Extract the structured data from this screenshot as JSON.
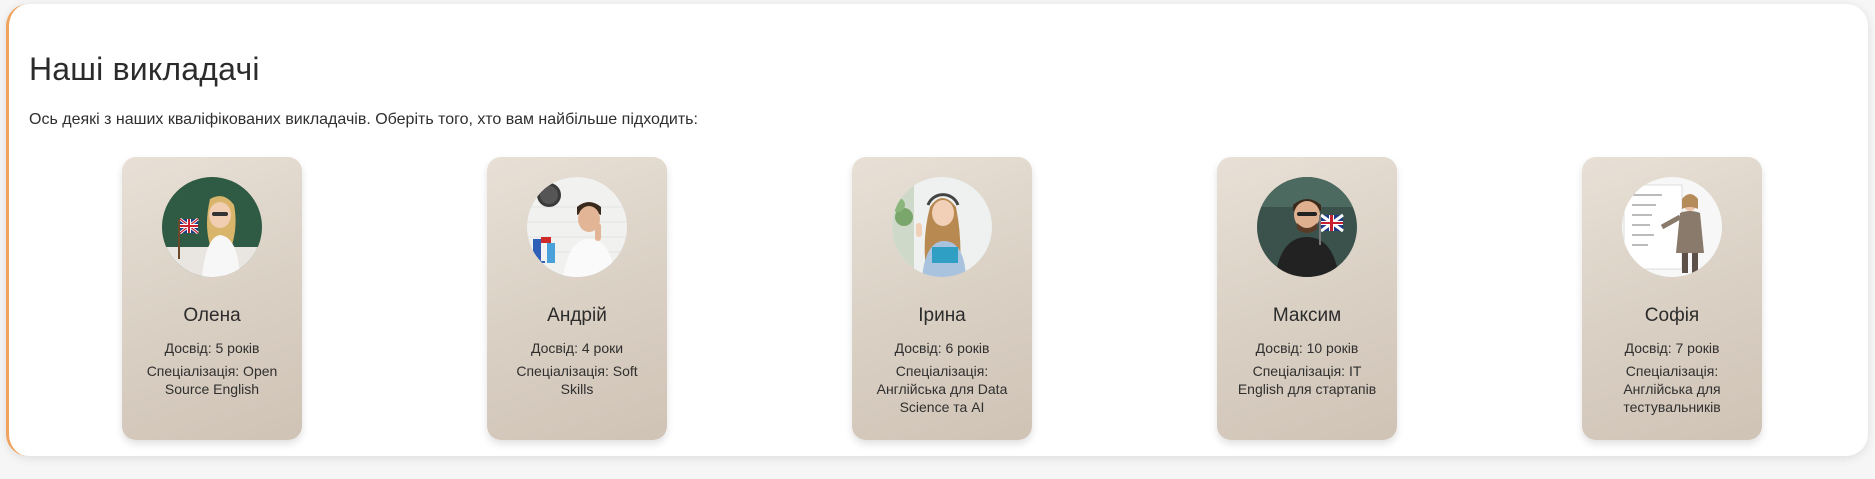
{
  "section": {
    "title": "Наші викладачі",
    "subtitle": "Ось деякі з наших кваліфікованих викладачів. Оберіть того, хто вам найбільше підходить:"
  },
  "accent_color": "#f0a35e",
  "teachers": [
    {
      "name": "Олена",
      "experience": "Досвід: 5 років",
      "specialization": "Спеціалізація: Open Source English"
    },
    {
      "name": "Андрій",
      "experience": "Досвід: 4 роки",
      "specialization": "Спеціалізація: Soft Skills"
    },
    {
      "name": "Ірина",
      "experience": "Досвід: 6 років",
      "specialization": "Спеціалізація: Англійська для Data Science та AI"
    },
    {
      "name": "Максим",
      "experience": "Досвід: 10 років",
      "specialization": "Спеціалізація: IT English для стартапів"
    },
    {
      "name": "Софія",
      "experience": "Досвід: 7 років",
      "specialization": "Спеціалізація: Англійська для тестувальників"
    }
  ]
}
